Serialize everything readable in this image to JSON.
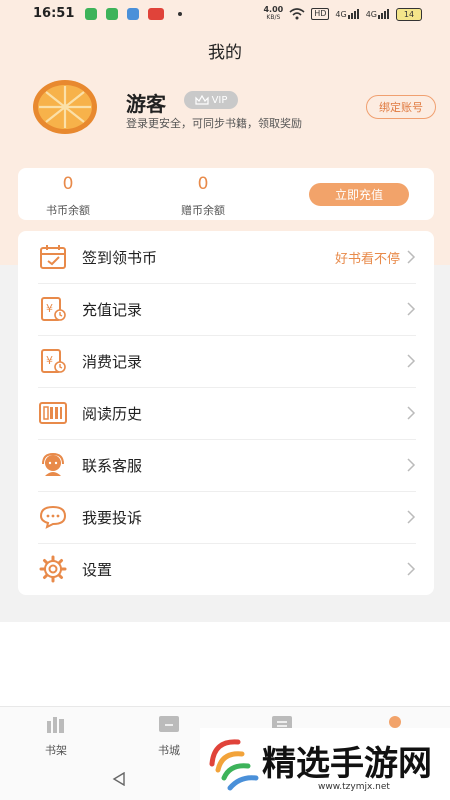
{
  "status_bar": {
    "time": "16:51",
    "network_speed": "4.00",
    "network_unit": "KB/S",
    "hd_badge": "HD",
    "signal_1": "4G",
    "signal_2": "4G",
    "battery": "14"
  },
  "page_title": "我的",
  "user": {
    "name": "游客",
    "vip_label": "VIP",
    "subtitle": "登录更安全，可同步书籍，领取奖励",
    "bind_button": "绑定账号"
  },
  "wallet": {
    "book_coin_value": "0",
    "book_coin_label": "书币余额",
    "gift_coin_value": "0",
    "gift_coin_label": "赠币余额",
    "recharge_button": "立即充值"
  },
  "menu": [
    {
      "label": "签到领书币",
      "extra": "好书看不停",
      "icon": "calendar-check-icon"
    },
    {
      "label": "充值记录",
      "extra": "",
      "icon": "recharge-record-icon"
    },
    {
      "label": "消费记录",
      "extra": "",
      "icon": "consume-record-icon"
    },
    {
      "label": "阅读历史",
      "extra": "",
      "icon": "reading-history-icon"
    },
    {
      "label": "联系客服",
      "extra": "",
      "icon": "customer-service-icon"
    },
    {
      "label": "我要投诉",
      "extra": "",
      "icon": "complaint-icon"
    },
    {
      "label": "设置",
      "extra": "",
      "icon": "gear-icon"
    }
  ],
  "tabs": [
    {
      "label": "书架",
      "icon": "bookshelf-icon"
    },
    {
      "label": "书城",
      "icon": "bookstore-icon"
    },
    {
      "label": "",
      "icon": "category-icon"
    },
    {
      "label": "",
      "icon": "profile-icon"
    }
  ],
  "watermark": {
    "text": "精选手游网",
    "url": "www.tzymjx.net"
  },
  "colors": {
    "accent": "#f2a36a",
    "accent_text": "#e88a4a",
    "header_bg": "#fcece1"
  }
}
